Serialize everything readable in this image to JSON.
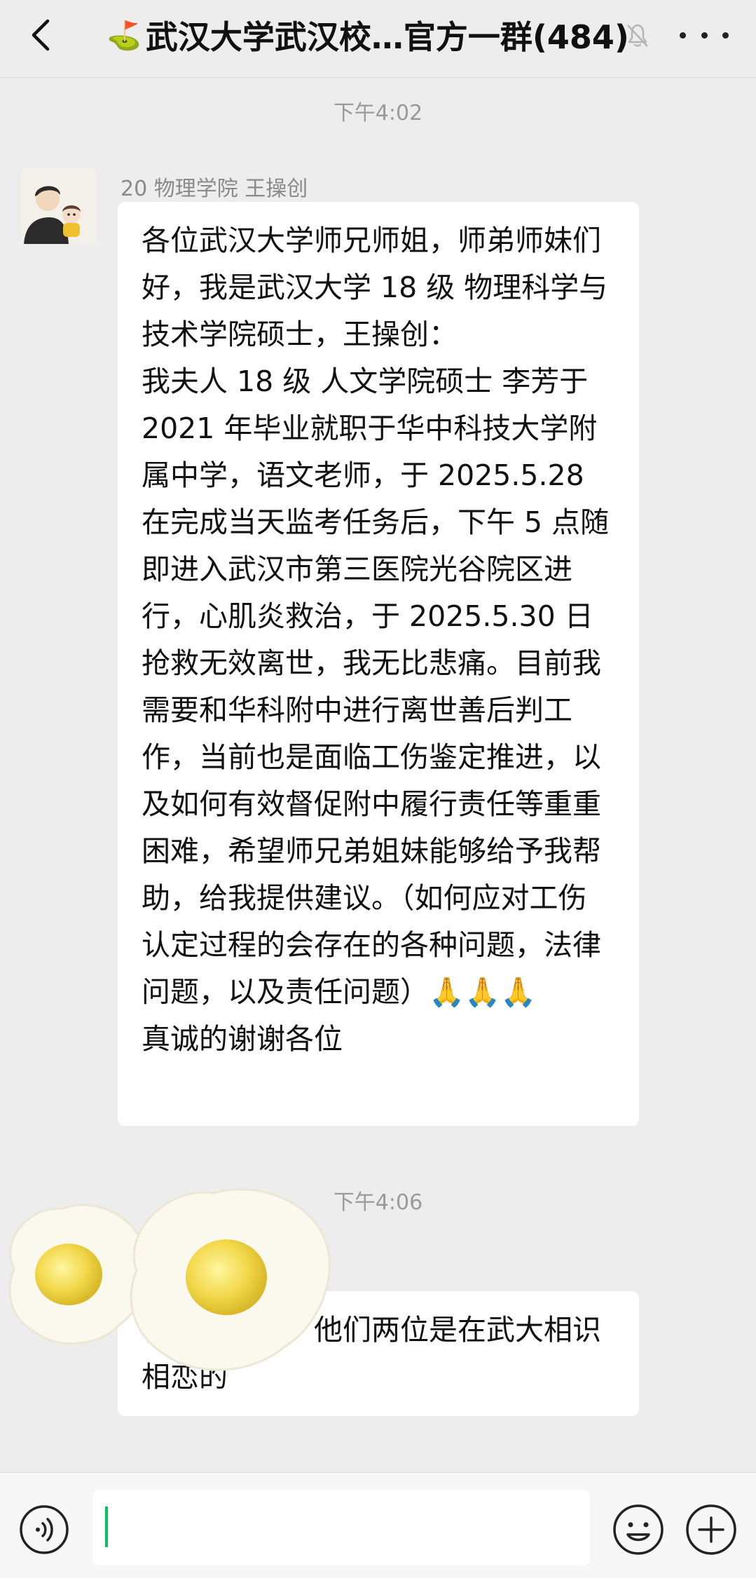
{
  "header": {
    "flag": "⛳",
    "title": "武汉大学武汉校…官方一群(484)"
  },
  "chat": {
    "timestamp1": "下午4:02",
    "message1": {
      "sender": "20 物理学院 王操创",
      "text": "各位武汉大学师兄师姐，师弟师妹们好，我是武汉大学 18 级 物理科学与技术学院硕士，王操创：\n我夫人 18 级 人文学院硕士 李芳于 2021 年毕业就职于华中科技大学附属中学，语文老师，于 2025.5.28 在完成当天监考任务后，下午 5 点随即进入武汉市第三医院光谷院区进行，心肌炎救治，于 2025.5.30 日抢救无效离世，我无比悲痛。目前我需要和华科附中进行离世善后判工作，当前也是面临工伤鉴定推进，以及如何有效督促附中履行责任等重重困难，希望师兄弟姐妹能够给予我帮助，给我提供建议。（如何应对工伤认定过程的会存在的各种问题，法律问题，以及责任问题）🙏🙏🙏\n真诚的谢谢各位"
    },
    "timestamp2": "下午4:06",
    "message2": {
      "text": "相　　一样，他们两位是在武大相识相恋的"
    }
  },
  "input": {
    "value": ""
  },
  "colors": {
    "background": "#ededed",
    "bubble": "#ffffff",
    "caret": "#07c160"
  }
}
